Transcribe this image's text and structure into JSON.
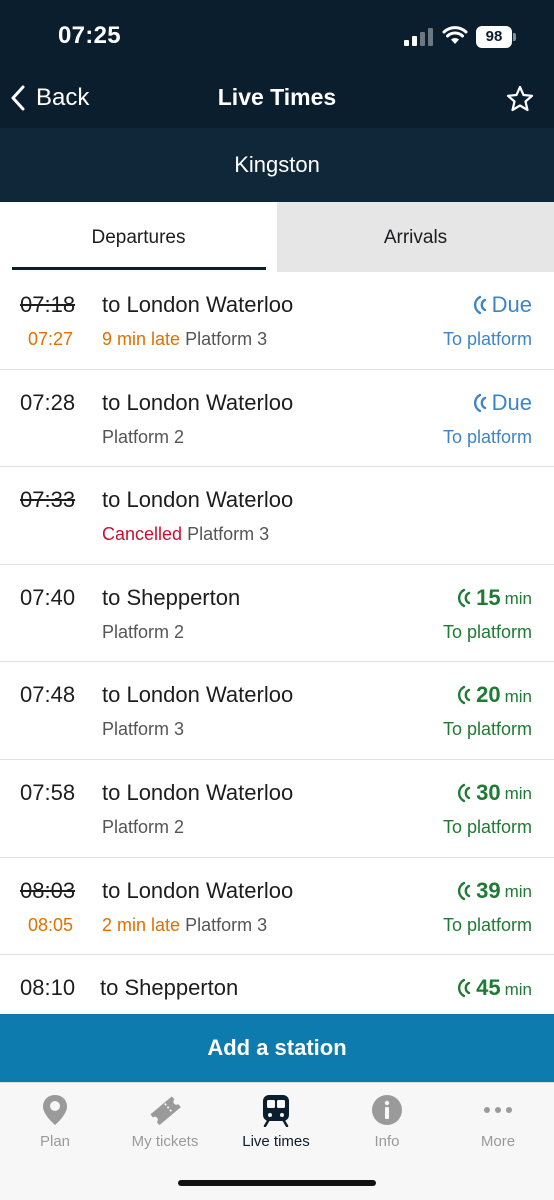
{
  "status_bar": {
    "time": "07:25",
    "battery": "98"
  },
  "nav": {
    "back_label": "Back",
    "title": "Live Times"
  },
  "station": {
    "name": "Kingston"
  },
  "tabs": {
    "departures": "Departures",
    "arrivals": "Arrivals"
  },
  "departures": [
    {
      "scheduled": "07:18",
      "expected": "07:27",
      "destination": "to London Waterloo",
      "status": "9 min late",
      "platform": "Platform 3",
      "eta": "Due",
      "eta_unit": "",
      "action": "To platform"
    },
    {
      "scheduled": "07:28",
      "expected": "",
      "destination": "to London Waterloo",
      "status": "",
      "platform": "Platform 2",
      "eta": "Due",
      "eta_unit": "",
      "action": "To platform"
    },
    {
      "scheduled": "07:33",
      "expected": "",
      "destination": "to London Waterloo",
      "status": "Cancelled",
      "platform": "Platform 3",
      "eta": "",
      "eta_unit": "",
      "action": ""
    },
    {
      "scheduled": "07:40",
      "expected": "",
      "destination": "to Shepperton",
      "status": "",
      "platform": "Platform 2",
      "eta": "15",
      "eta_unit": "min",
      "action": "To platform"
    },
    {
      "scheduled": "07:48",
      "expected": "",
      "destination": "to London Waterloo",
      "status": "",
      "platform": "Platform 3",
      "eta": "20",
      "eta_unit": "min",
      "action": "To platform"
    },
    {
      "scheduled": "07:58",
      "expected": "",
      "destination": "to London Waterloo",
      "status": "",
      "platform": "Platform 2",
      "eta": "30",
      "eta_unit": "min",
      "action": "To platform"
    },
    {
      "scheduled": "08:03",
      "expected": "08:05",
      "destination": "to London Waterloo",
      "status": "2 min late",
      "platform": "Platform 3",
      "eta": "39",
      "eta_unit": "min",
      "action": "To platform"
    },
    {
      "scheduled": "08:10",
      "expected": "",
      "destination": "to Shepperton",
      "status": "",
      "platform": "",
      "eta": "45",
      "eta_unit": "min",
      "action": ""
    }
  ],
  "add_station_label": "Add a station",
  "tabbar": [
    {
      "label": "Plan",
      "icon": "location-pin-icon"
    },
    {
      "label": "My tickets",
      "icon": "ticket-icon"
    },
    {
      "label": "Live times",
      "icon": "train-icon"
    },
    {
      "label": "Info",
      "icon": "info-icon"
    },
    {
      "label": "More",
      "icon": "more-dots-icon"
    }
  ],
  "colors": {
    "header": "#0b1e2d",
    "accent_blue": "#3d85c6",
    "green": "#1f7a33",
    "late": "#e07000",
    "cancelled": "#c8102e",
    "button": "#0d7bad"
  }
}
